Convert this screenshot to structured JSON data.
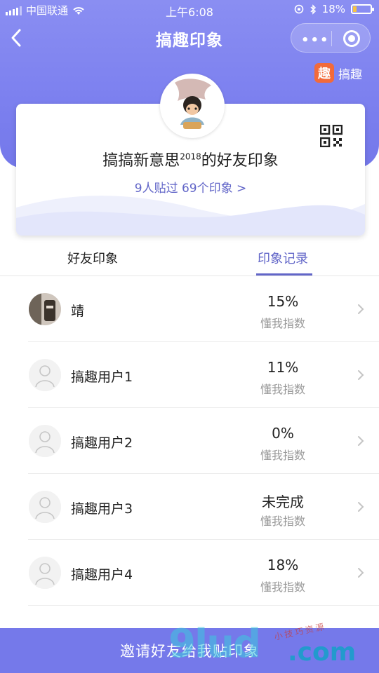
{
  "status_bar": {
    "carrier": "中国联通",
    "time": "上午6:08",
    "battery_text": "18%",
    "battery_level": 0.18
  },
  "nav": {
    "title": "搞趣印象"
  },
  "brand": {
    "logo_char": "趣",
    "label": "搞趣"
  },
  "profile": {
    "name": "搞搞新意思",
    "superscript": "2018",
    "title_suffix": "的好友印象",
    "summary": "9人贴过 69个印象 >"
  },
  "tabs": [
    {
      "label": "好友印象",
      "active": false
    },
    {
      "label": "印象记录",
      "active": true
    }
  ],
  "friends": [
    {
      "name": "靖",
      "score": "15%",
      "score_label": "懂我指数",
      "avatar": "photo"
    },
    {
      "name": "搞趣用户1",
      "score": "11%",
      "score_label": "懂我指数",
      "avatar": "default"
    },
    {
      "name": "搞趣用户2",
      "score": "0%",
      "score_label": "懂我指数",
      "avatar": "default"
    },
    {
      "name": "搞趣用户3",
      "score": "未完成",
      "score_label": "懂我指数",
      "avatar": "default"
    },
    {
      "name": "搞趣用户4",
      "score": "18%",
      "score_label": "懂我指数",
      "avatar": "default"
    }
  ],
  "invite_button": "邀请好友给我贴印象",
  "watermark": {
    "big": "9lud",
    "com": ".com",
    "small": "小技巧资源"
  },
  "colors": {
    "accent": "#6266c8",
    "header": "#7c80ef",
    "brand_logo": "#f26a3a"
  }
}
